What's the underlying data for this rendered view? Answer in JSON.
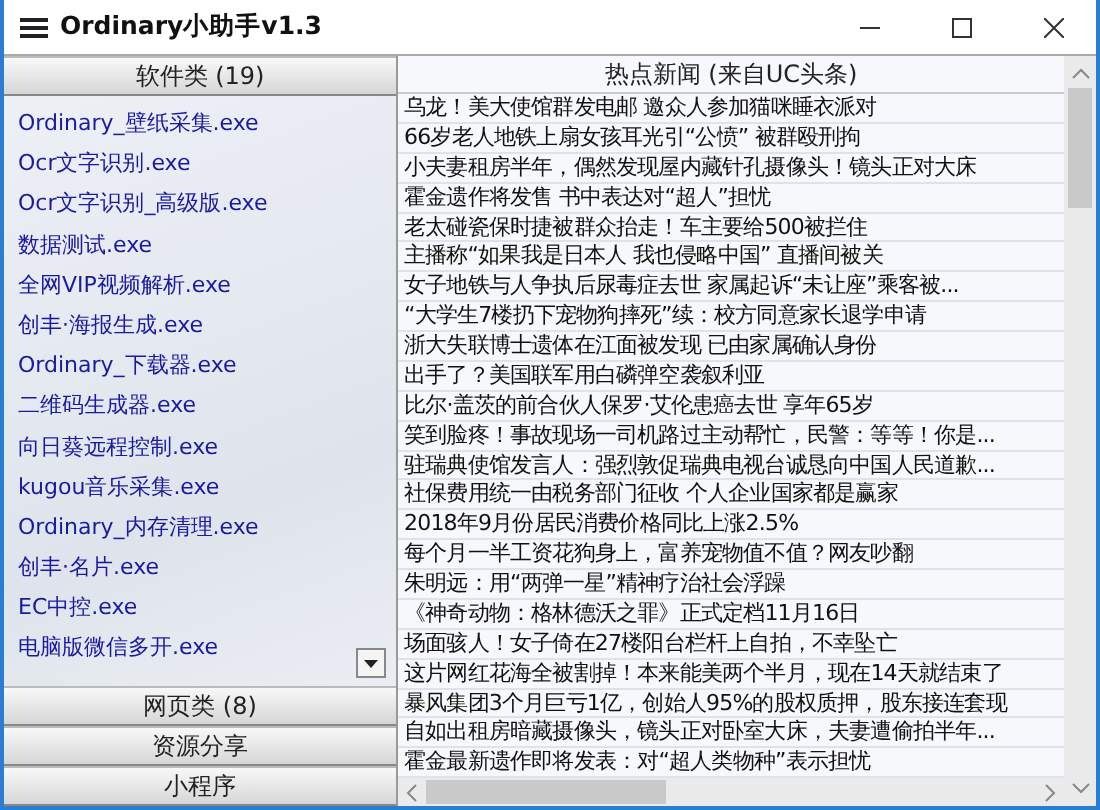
{
  "window": {
    "title": "Ordinary小助手v1.3"
  },
  "sections": [
    {
      "title": "软件类 (19)",
      "expanded": true,
      "items": [
        "Ordinary_壁纸采集.exe",
        "Ocr文字识别.exe",
        "Ocr文字识别_高级版.exe",
        "数据测试.exe",
        "全网VIP视频解析.exe",
        "创丰·海报生成.exe",
        "Ordinary_下载器.exe",
        "二维码生成器.exe",
        "向日葵远程控制.exe",
        "kugou音乐采集.exe",
        "Ordinary_内存清理.exe",
        "创丰·名片.exe",
        "EC中控.exe",
        "电脑版微信多开.exe"
      ]
    },
    {
      "title": "网页类 (8)",
      "expanded": false
    },
    {
      "title": "资源分享",
      "expanded": false
    },
    {
      "title": "小程序",
      "expanded": false
    }
  ],
  "news": {
    "title": "热点新闻 (来自UC头条)",
    "items": [
      "乌龙！美大使馆群发电邮 邀众人参加猫咪睡衣派对",
      "66岁老人地铁上扇女孩耳光引“公愤” 被群殴刑拘",
      "小夫妻租房半年，偶然发现屋内藏针孔摄像头！镜头正对大床",
      "霍金遗作将发售 书中表达对“超人”担忧",
      "老太碰瓷保时捷被群众抬走！车主要给500被拦住",
      "主播称“如果我是日本人 我也侵略中国” 直播间被关",
      "女子地铁与人争执后尿毒症去世 家属起诉“未让座”乘客被...",
      "“大学生7楼扔下宠物狗摔死”续：校方同意家长退学申请",
      "浙大失联博士遗体在江面被发现 已由家属确认身份",
      "出手了？美国联军用白磷弹空袭叙利亚",
      "比尔·盖茨的前合伙人保罗·艾伦患癌去世 享年65岁",
      "笑到脸疼！事故现场一司机路过主动帮忙，民警：等等！你是...",
      "驻瑞典使馆发言人：强烈敦促瑞典电视台诚恳向中国人民道歉...",
      "社保费用统一由税务部门征收 个人企业国家都是赢家",
      "2018年9月份居民消费价格同比上涨2.5%",
      "每个月一半工资花狗身上，富养宠物值不值？网友吵翻",
      "朱明远：用“两弹一星”精神疗治社会浮躁",
      "《神奇动物：格林德沃之罪》正式定档11月16日",
      "场面骇人！女子倚在27楼阳台栏杆上自拍，不幸坠亡",
      "这片网红花海全被割掉！本来能美两个半月，现在14天就结束了",
      "暴风集团3个月巨亏1亿，创始人95%的股权质押，股东接连套现",
      "自如出租房暗藏摄像头，镜头正对卧室大床，夫妻遭偷拍半年...",
      "霍金最新遗作即将发表：对“超人类物种”表示担忧"
    ]
  }
}
